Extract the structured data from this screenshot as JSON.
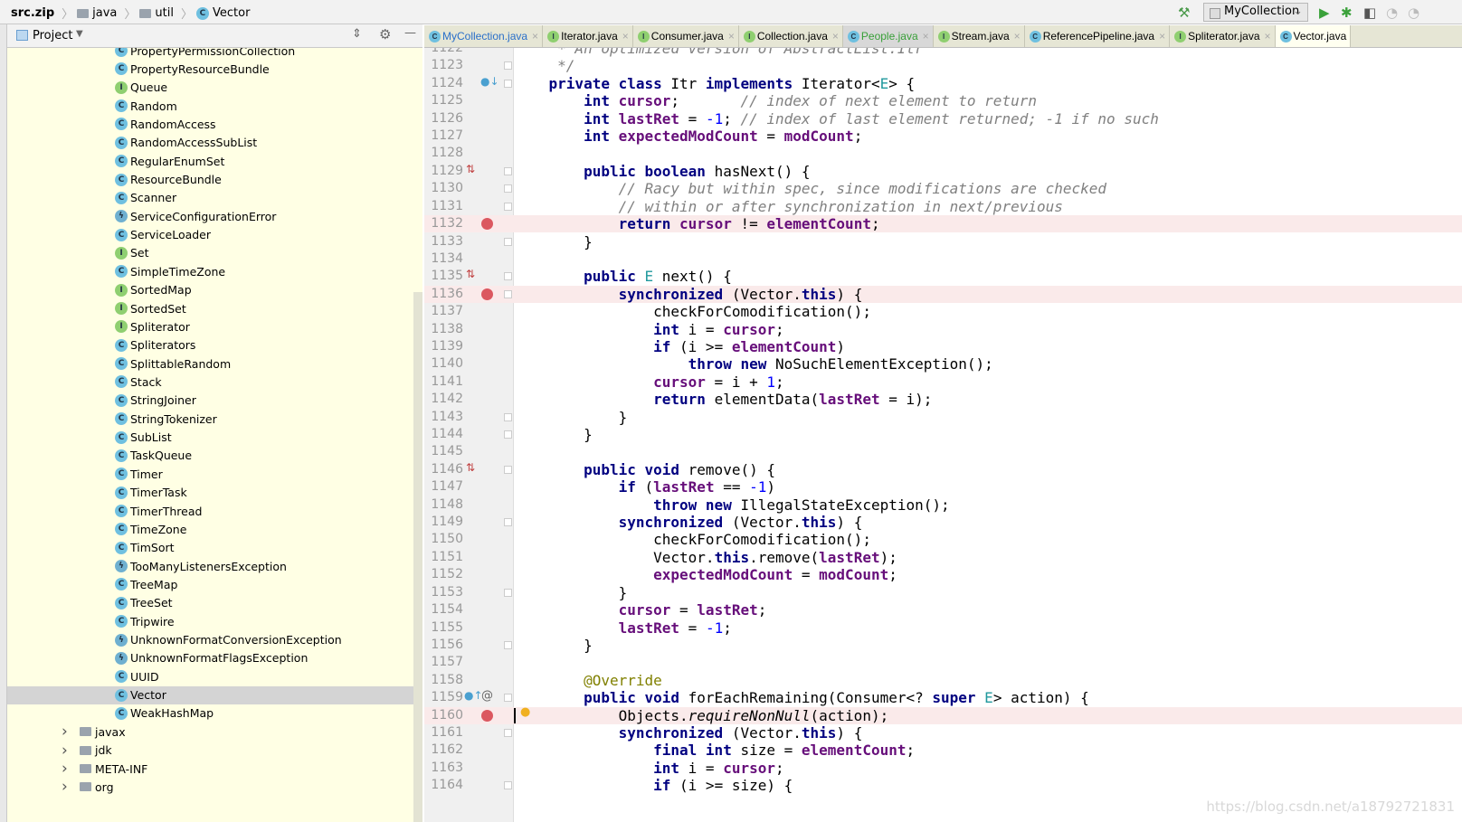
{
  "breadcrumb": [
    "src.zip",
    "java",
    "util",
    "Vector"
  ],
  "toolbar": {
    "run_config": "MyCollection"
  },
  "project_panel": {
    "title": "Project"
  },
  "tree": {
    "items": [
      {
        "label": "PropertyPermissionCollection",
        "kind": "class"
      },
      {
        "label": "PropertyResourceBundle",
        "kind": "class"
      },
      {
        "label": "Queue",
        "kind": "interface"
      },
      {
        "label": "Random",
        "kind": "class"
      },
      {
        "label": "RandomAccess",
        "kind": "class"
      },
      {
        "label": "RandomAccessSubList",
        "kind": "class"
      },
      {
        "label": "RegularEnumSet",
        "kind": "class"
      },
      {
        "label": "ResourceBundle",
        "kind": "class"
      },
      {
        "label": "Scanner",
        "kind": "class"
      },
      {
        "label": "ServiceConfigurationError",
        "kind": "exception"
      },
      {
        "label": "ServiceLoader",
        "kind": "class"
      },
      {
        "label": "Set",
        "kind": "interface"
      },
      {
        "label": "SimpleTimeZone",
        "kind": "class"
      },
      {
        "label": "SortedMap",
        "kind": "interface"
      },
      {
        "label": "SortedSet",
        "kind": "interface"
      },
      {
        "label": "Spliterator",
        "kind": "interface"
      },
      {
        "label": "Spliterators",
        "kind": "class"
      },
      {
        "label": "SplittableRandom",
        "kind": "class"
      },
      {
        "label": "Stack",
        "kind": "class"
      },
      {
        "label": "StringJoiner",
        "kind": "class"
      },
      {
        "label": "StringTokenizer",
        "kind": "class"
      },
      {
        "label": "SubList",
        "kind": "class"
      },
      {
        "label": "TaskQueue",
        "kind": "class"
      },
      {
        "label": "Timer",
        "kind": "class"
      },
      {
        "label": "TimerTask",
        "kind": "class"
      },
      {
        "label": "TimerThread",
        "kind": "class"
      },
      {
        "label": "TimeZone",
        "kind": "class"
      },
      {
        "label": "TimSort",
        "kind": "class"
      },
      {
        "label": "TooManyListenersException",
        "kind": "exception"
      },
      {
        "label": "TreeMap",
        "kind": "class"
      },
      {
        "label": "TreeSet",
        "kind": "class"
      },
      {
        "label": "Tripwire",
        "kind": "class"
      },
      {
        "label": "UnknownFormatConversionException",
        "kind": "exception"
      },
      {
        "label": "UnknownFormatFlagsException",
        "kind": "exception"
      },
      {
        "label": "UUID",
        "kind": "class"
      },
      {
        "label": "Vector",
        "kind": "class",
        "selected": true
      },
      {
        "label": "WeakHashMap",
        "kind": "class"
      }
    ],
    "folders": [
      "javax",
      "jdk",
      "META-INF",
      "org"
    ]
  },
  "tabs": [
    {
      "label": "MyCollection.java",
      "kind": "class",
      "color": "blue"
    },
    {
      "label": "Iterator.java",
      "kind": "interface"
    },
    {
      "label": "Consumer.java",
      "kind": "interface"
    },
    {
      "label": "Collection.java",
      "kind": "interface"
    },
    {
      "label": "People.java",
      "kind": "class",
      "color": "green"
    },
    {
      "label": "Stream.java",
      "kind": "interface"
    },
    {
      "label": "ReferencePipeline.java",
      "kind": "class"
    },
    {
      "label": "Spliterator.java",
      "kind": "interface"
    },
    {
      "label": "Vector.java",
      "kind": "class",
      "active": true
    }
  ],
  "editor": {
    "first_line": 1122,
    "breakpoint_lines": [
      1132,
      1136,
      1160
    ],
    "lines": [
      [
        [
          "cm",
          "     * An optimized version of AbstractList.Itr"
        ]
      ],
      [
        [
          "cm",
          "     */"
        ]
      ],
      [
        [
          "",
          "    "
        ],
        [
          "kw",
          "private class "
        ],
        [
          "",
          "Itr "
        ],
        [
          "kw",
          "implements "
        ],
        [
          "",
          "Iterator<"
        ],
        [
          "tp",
          "E"
        ],
        [
          "",
          "> {"
        ]
      ],
      [
        [
          "",
          "        "
        ],
        [
          "kw",
          "int "
        ],
        [
          "fld",
          "cursor"
        ],
        [
          "",
          ";       "
        ],
        [
          "cm",
          "// index of next element to return"
        ]
      ],
      [
        [
          "",
          "        "
        ],
        [
          "kw",
          "int "
        ],
        [
          "fld",
          "lastRet"
        ],
        [
          "",
          " = "
        ],
        [
          "num",
          "-1"
        ],
        [
          "",
          "; "
        ],
        [
          "cm",
          "// index of last element returned; -1 if no such"
        ]
      ],
      [
        [
          "",
          "        "
        ],
        [
          "kw",
          "int "
        ],
        [
          "fld",
          "expectedModCount"
        ],
        [
          "",
          " = "
        ],
        [
          "fld",
          "modCount"
        ],
        [
          "",
          ";"
        ]
      ],
      [],
      [
        [
          "",
          "        "
        ],
        [
          "kw",
          "public boolean "
        ],
        [
          "",
          "hasNext() {"
        ]
      ],
      [
        [
          "",
          "            "
        ],
        [
          "cm",
          "// Racy but within spec, since modifications are checked"
        ]
      ],
      [
        [
          "",
          "            "
        ],
        [
          "cm",
          "// within or after synchronization in next/previous"
        ]
      ],
      [
        [
          "",
          "            "
        ],
        [
          "kw",
          "return "
        ],
        [
          "fld",
          "cursor"
        ],
        [
          "",
          " != "
        ],
        [
          "fld",
          "elementCount"
        ],
        [
          "",
          ";"
        ]
      ],
      [
        [
          "",
          "        }"
        ]
      ],
      [],
      [
        [
          "",
          "        "
        ],
        [
          "kw",
          "public "
        ],
        [
          "tp",
          "E "
        ],
        [
          "",
          "next() {"
        ]
      ],
      [
        [
          "",
          "            "
        ],
        [
          "kw",
          "synchronized "
        ],
        [
          "",
          "(Vector."
        ],
        [
          "kw",
          "this"
        ],
        [
          "",
          ") {"
        ]
      ],
      [
        [
          "",
          "                checkForComodification();"
        ]
      ],
      [
        [
          "",
          "                "
        ],
        [
          "kw",
          "int "
        ],
        [
          "",
          "i = "
        ],
        [
          "fld",
          "cursor"
        ],
        [
          "",
          ";"
        ]
      ],
      [
        [
          "",
          "                "
        ],
        [
          "kw",
          "if "
        ],
        [
          "",
          "(i >= "
        ],
        [
          "fld",
          "elementCount"
        ],
        [
          "",
          ")"
        ]
      ],
      [
        [
          "",
          "                    "
        ],
        [
          "kw",
          "throw new "
        ],
        [
          "",
          "NoSuchElementException();"
        ]
      ],
      [
        [
          "",
          "                "
        ],
        [
          "fld",
          "cursor"
        ],
        [
          "",
          " = i + "
        ],
        [
          "num",
          "1"
        ],
        [
          "",
          ";"
        ]
      ],
      [
        [
          "",
          "                "
        ],
        [
          "kw",
          "return "
        ],
        [
          "",
          "elementData("
        ],
        [
          "fld",
          "lastRet"
        ],
        [
          "",
          " = i);"
        ]
      ],
      [
        [
          "",
          "            }"
        ]
      ],
      [
        [
          "",
          "        }"
        ]
      ],
      [],
      [
        [
          "",
          "        "
        ],
        [
          "kw",
          "public void "
        ],
        [
          "",
          "remove() {"
        ]
      ],
      [
        [
          "",
          "            "
        ],
        [
          "kw",
          "if "
        ],
        [
          "",
          "("
        ],
        [
          "fld",
          "lastRet"
        ],
        [
          "",
          " == "
        ],
        [
          "num",
          "-1"
        ],
        [
          "",
          ")"
        ]
      ],
      [
        [
          "",
          "                "
        ],
        [
          "kw",
          "throw new "
        ],
        [
          "",
          "IllegalStateException();"
        ]
      ],
      [
        [
          "",
          "            "
        ],
        [
          "kw",
          "synchronized "
        ],
        [
          "",
          "(Vector."
        ],
        [
          "kw",
          "this"
        ],
        [
          "",
          ") {"
        ]
      ],
      [
        [
          "",
          "                checkForComodification();"
        ]
      ],
      [
        [
          "",
          "                Vector."
        ],
        [
          "kw",
          "this"
        ],
        [
          "",
          ".remove("
        ],
        [
          "fld",
          "lastRet"
        ],
        [
          "",
          ");"
        ]
      ],
      [
        [
          "",
          "                "
        ],
        [
          "fld",
          "expectedModCount"
        ],
        [
          "",
          " = "
        ],
        [
          "fld",
          "modCount"
        ],
        [
          "",
          ";"
        ]
      ],
      [
        [
          "",
          "            }"
        ]
      ],
      [
        [
          "",
          "            "
        ],
        [
          "fld",
          "cursor"
        ],
        [
          "",
          " = "
        ],
        [
          "fld",
          "lastRet"
        ],
        [
          "",
          ";"
        ]
      ],
      [
        [
          "",
          "            "
        ],
        [
          "fld",
          "lastRet"
        ],
        [
          "",
          " = "
        ],
        [
          "num",
          "-1"
        ],
        [
          "",
          ";"
        ]
      ],
      [
        [
          "",
          "        }"
        ]
      ],
      [],
      [
        [
          "",
          "        "
        ],
        [
          "ann",
          "@Override"
        ]
      ],
      [
        [
          "",
          "        "
        ],
        [
          "kw",
          "public void "
        ],
        [
          "",
          "forEachRemaining(Consumer<? "
        ],
        [
          "kw",
          "super "
        ],
        [
          "tp",
          "E"
        ],
        [
          "",
          "> action) {"
        ]
      ],
      [
        [
          "",
          "            Objects."
        ],
        [
          "it",
          "requireNonNull"
        ],
        [
          "",
          "(action);"
        ]
      ],
      [
        [
          "",
          "            "
        ],
        [
          "kw",
          "synchronized "
        ],
        [
          "",
          "(Vector."
        ],
        [
          "kw",
          "this"
        ],
        [
          "",
          ") {"
        ]
      ],
      [
        [
          "",
          "                "
        ],
        [
          "kw",
          "final int "
        ],
        [
          "",
          "size = "
        ],
        [
          "fld",
          "elementCount"
        ],
        [
          "",
          ";"
        ]
      ],
      [
        [
          "",
          "                "
        ],
        [
          "kw",
          "int "
        ],
        [
          "",
          "i = "
        ],
        [
          "fld",
          "cursor"
        ],
        [
          "",
          ";"
        ]
      ],
      [
        [
          "",
          "                "
        ],
        [
          "kw",
          "if "
        ],
        [
          "",
          "(i >= size) {"
        ]
      ]
    ],
    "fold_lines": [
      1123,
      1124,
      1129,
      1130,
      1131,
      1133,
      1135,
      1136,
      1143,
      1144,
      1146,
      1149,
      1153,
      1156,
      1159,
      1161,
      1164
    ],
    "implements_lines": [
      1129,
      1135,
      1146
    ],
    "override_lines": [
      1124,
      1159
    ]
  },
  "watermark": "https://blog.csdn.net/a18792721831"
}
